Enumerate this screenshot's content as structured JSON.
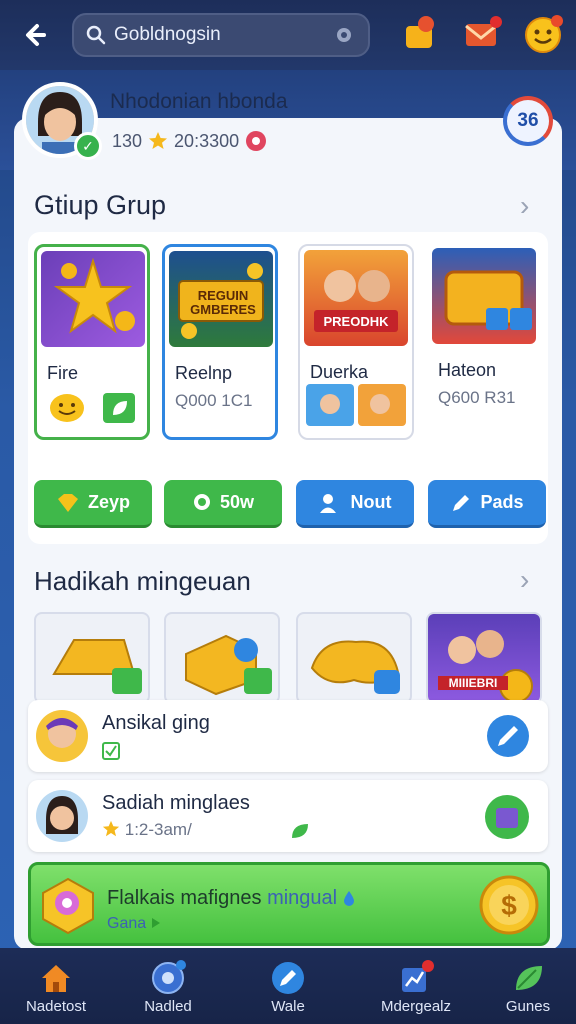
{
  "topbar": {
    "search_text": "Gobldnogsin"
  },
  "profile": {
    "name": "Nhodonian hbonda",
    "stat1": "130",
    "stat2": "20:3300",
    "level": "36"
  },
  "group": {
    "title": "Gtiup Grup",
    "cards": [
      {
        "name": "Fire",
        "sub": ""
      },
      {
        "name": "Reelnp",
        "sub": "Q000 1C1"
      },
      {
        "name": "Duerka",
        "sub": ""
      },
      {
        "name": "Hateon",
        "sub": "Q600 R31"
      }
    ],
    "art_texts": {
      "card2_banner": "REGUIN GMBERES",
      "card3_banner": "PREODHK"
    },
    "actions": [
      {
        "label": "Zeyp"
      },
      {
        "label": "50w"
      },
      {
        "label": "Nout"
      },
      {
        "label": "Pads"
      }
    ]
  },
  "daily": {
    "title": "Hadikah mingeuan",
    "tile4_text": "MIIIEBRI"
  },
  "list": [
    {
      "title": "Ansikal ging",
      "sub": ""
    },
    {
      "title": "Sadiah minglaes",
      "sub": "1:2-3am/"
    }
  ],
  "promo": {
    "title": "Flalkais mafignes",
    "title_accent": "mingual",
    "sub": "Gana"
  },
  "bottom_nav": [
    {
      "label": "Nadetost"
    },
    {
      "label": "Nadled"
    },
    {
      "label": "Wale"
    },
    {
      "label": "Mdergealz"
    },
    {
      "label": "Gunes"
    }
  ],
  "colors": {
    "accent_green": "#3fb84a",
    "accent_blue": "#2f86e0",
    "top_bar": "#1d2e5a",
    "panel": "#f3f6fb"
  }
}
